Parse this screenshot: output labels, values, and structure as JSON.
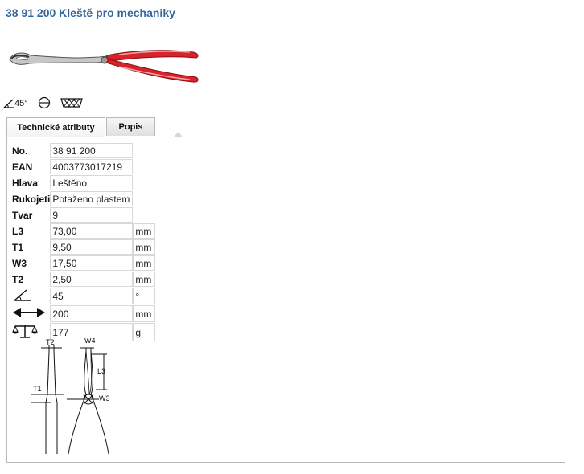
{
  "product": {
    "title": "38 91 200 Kleště pro mechaniky",
    "image_icon": "pliers-product-image",
    "colors": {
      "title": "#33679a",
      "handle": "#d8232a",
      "border": "#b9b9b9"
    }
  },
  "features": {
    "angle_label": "45°",
    "icons": [
      "angle-45-icon",
      "polished-head-icon",
      "serrated-jaw-icon"
    ]
  },
  "tabs": [
    {
      "label": "Technické atributy",
      "active": true
    },
    {
      "label": "Popis",
      "active": false
    }
  ],
  "attributes": [
    {
      "label": "No.",
      "value": "38 91 200",
      "unit": ""
    },
    {
      "label": "EAN",
      "value": "4003773017219",
      "unit": ""
    },
    {
      "label": "Hlava",
      "value": "Leštěno",
      "unit": ""
    },
    {
      "label": "Rukojeti",
      "value": "Potaženo plastem",
      "unit": ""
    },
    {
      "label": "Tvar",
      "value": "9",
      "unit": ""
    },
    {
      "label": "L3",
      "value": "73,00",
      "unit": "mm"
    },
    {
      "label": "T1",
      "value": "9,50",
      "unit": "mm"
    },
    {
      "label": "W3",
      "value": "17,50",
      "unit": "mm"
    },
    {
      "label": "T2",
      "value": "2,50",
      "unit": "mm"
    },
    {
      "label": "",
      "icon": "angle-icon",
      "value": "45",
      "unit": "°"
    },
    {
      "label": "",
      "icon": "length-arrow-icon",
      "value": "200",
      "unit": "mm"
    },
    {
      "label": "",
      "icon": "weight-scale-icon",
      "value": "177",
      "unit": "g"
    }
  ],
  "drawing": {
    "labels": {
      "t2": "T2",
      "w4": "W4",
      "l3": "L3",
      "t1": "T1",
      "w3": "W3"
    }
  }
}
